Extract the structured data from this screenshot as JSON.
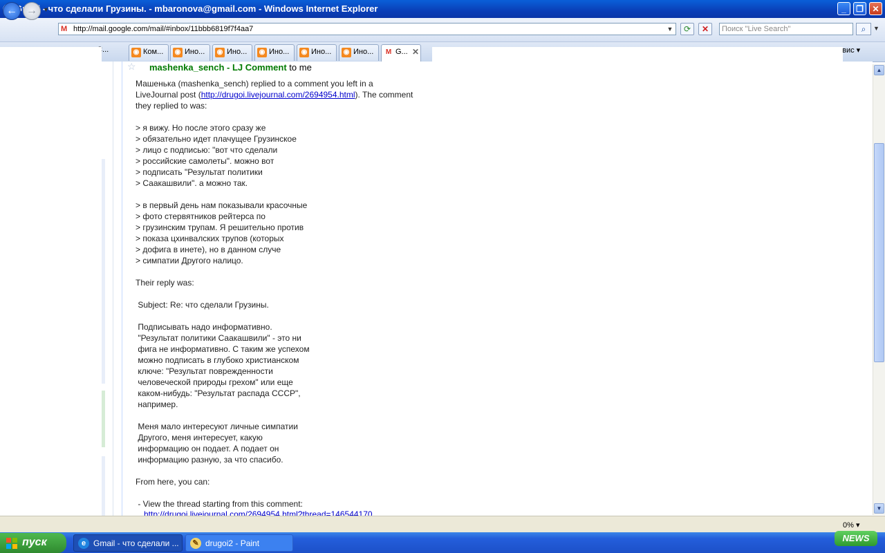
{
  "window": {
    "title": "Gmail - что сделали Грузины. - mbaronova@gmail.com - Windows Internet Explorer"
  },
  "address": {
    "url": "http://mail.google.com/mail/#inbox/11bbb6819f7f4aa7"
  },
  "search": {
    "placeholder": "Поиск \"Live Search\""
  },
  "tabs": [
    {
      "label": "Ком..."
    },
    {
      "label": "Ино..."
    },
    {
      "label": "Ино..."
    },
    {
      "label": "Ино..."
    },
    {
      "label": "Ино..."
    },
    {
      "label": "Ино..."
    },
    {
      "label": "G..."
    }
  ],
  "partial_tab_label": "поС...",
  "toolbar_right": "рвис",
  "email": {
    "sender": "mashenka_sench - LJ Comment",
    "to": " to me",
    "intro_1": "Машенька (mashenka_sench) replied to a comment you left in a",
    "intro_2a": "LiveJournal post (",
    "intro_link": "http://drugoi.livejournal.com/2694954.html",
    "intro_2b": "). The comment",
    "intro_3": "they replied to was:",
    "quote_1": "> я вижу. Но после этого сразу же\n> обязательно идет плачущее Грузинское\n> лицо с подписью: \"вот что сделали\n> российские самолеты\". можно вот\n> подписать \"Результат политики\n> Саакашвили\". а можно так.",
    "quote_2": "> в первый день нам показывали красочные\n> фото стервятников рейтерса по\n> грузинским трупам. Я решительно против\n> показа цхинвалских трупов (которых\n> дофига в инете), но в данном случе\n> симпатии Другого налицо.",
    "reply_heading": "Their reply was:",
    "reply_subject": " Subject: Re: что сделали Грузины.",
    "reply_p1": " Подписывать надо информативно.\n \"Результат политики Саакашвили\" - это ни\n фига не информативно. С таким же успехом\n можно подписать в глубоко христианском\n ключе: \"Результат поврежденности\n человеческой природы грехом\" или еще\n каком-нибудь: \"Результат распада СССР\",\n например.",
    "reply_p2": " Меня мало интересуют личные симпатии\n Другого, меня интересует, какую\n информацию он подает. А подает он\n информацию разную, за что спасибо.",
    "from_here": "From here, you can:",
    "view_thread": " - View the thread starting from this comment:",
    "thread_url": "http://drugoi.livejournal.com/2694954.html?thread=146544170"
  },
  "status": {
    "zoom": "0%"
  },
  "taskbar": {
    "start": "пуск",
    "items": [
      {
        "label": "Gmail - что сделали ..."
      },
      {
        "label": "drugoi2 - Paint"
      }
    ],
    "news": "NEWS"
  },
  "colors": {
    "titlebar": "#0a3fb8",
    "sender": "#007a00",
    "link": "#0000cc",
    "taskbar": "#245edb",
    "start": "#2f8a2f"
  },
  "icons": [
    "ie-icon",
    "back-arrow-icon",
    "forward-arrow-icon",
    "gmail-icon",
    "refresh-icon",
    "stop-icon",
    "search-icon",
    "star-icon",
    "rss-icon",
    "windows-flag-icon",
    "paint-icon"
  ]
}
